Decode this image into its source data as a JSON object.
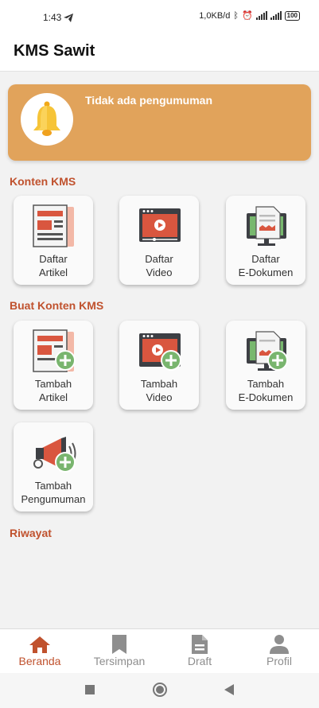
{
  "status": {
    "time": "1:43",
    "net_speed": "1,0KB/d",
    "battery": "100"
  },
  "app": {
    "title": "KMS Sawit"
  },
  "announcement": {
    "text": "Tidak ada pengumuman",
    "icon": "bell-icon"
  },
  "sections": {
    "konten": {
      "title": "Konten KMS"
    },
    "buat": {
      "title": "Buat Konten KMS"
    },
    "riwayat": {
      "title": "Riwayat"
    }
  },
  "konten_items": [
    {
      "label": "Daftar\nArtikel",
      "icon": "article-icon"
    },
    {
      "label": "Daftar\nVideo",
      "icon": "video-icon"
    },
    {
      "label": "Daftar\nE-Dokumen",
      "icon": "document-icon"
    }
  ],
  "buat_items": [
    {
      "label": "Tambah\nArtikel",
      "icon": "add-article-icon"
    },
    {
      "label": "Tambah\nVideo",
      "icon": "add-video-icon"
    },
    {
      "label": "Tambah\nE-Dokumen",
      "icon": "add-document-icon"
    },
    {
      "label": "Tambah\nPengumuman",
      "icon": "add-announcement-icon"
    }
  ],
  "nav": [
    {
      "label": "Beranda",
      "icon": "home-icon",
      "active": true
    },
    {
      "label": "Tersimpan",
      "icon": "bookmark-icon",
      "active": false
    },
    {
      "label": "Draft",
      "icon": "draft-icon",
      "active": false
    },
    {
      "label": "Profil",
      "icon": "profile-icon",
      "active": false
    }
  ],
  "colors": {
    "accent": "#c0522e",
    "banner": "#e1a35b",
    "plus": "#79b56e",
    "nav_inactive": "#8e8e8e"
  }
}
